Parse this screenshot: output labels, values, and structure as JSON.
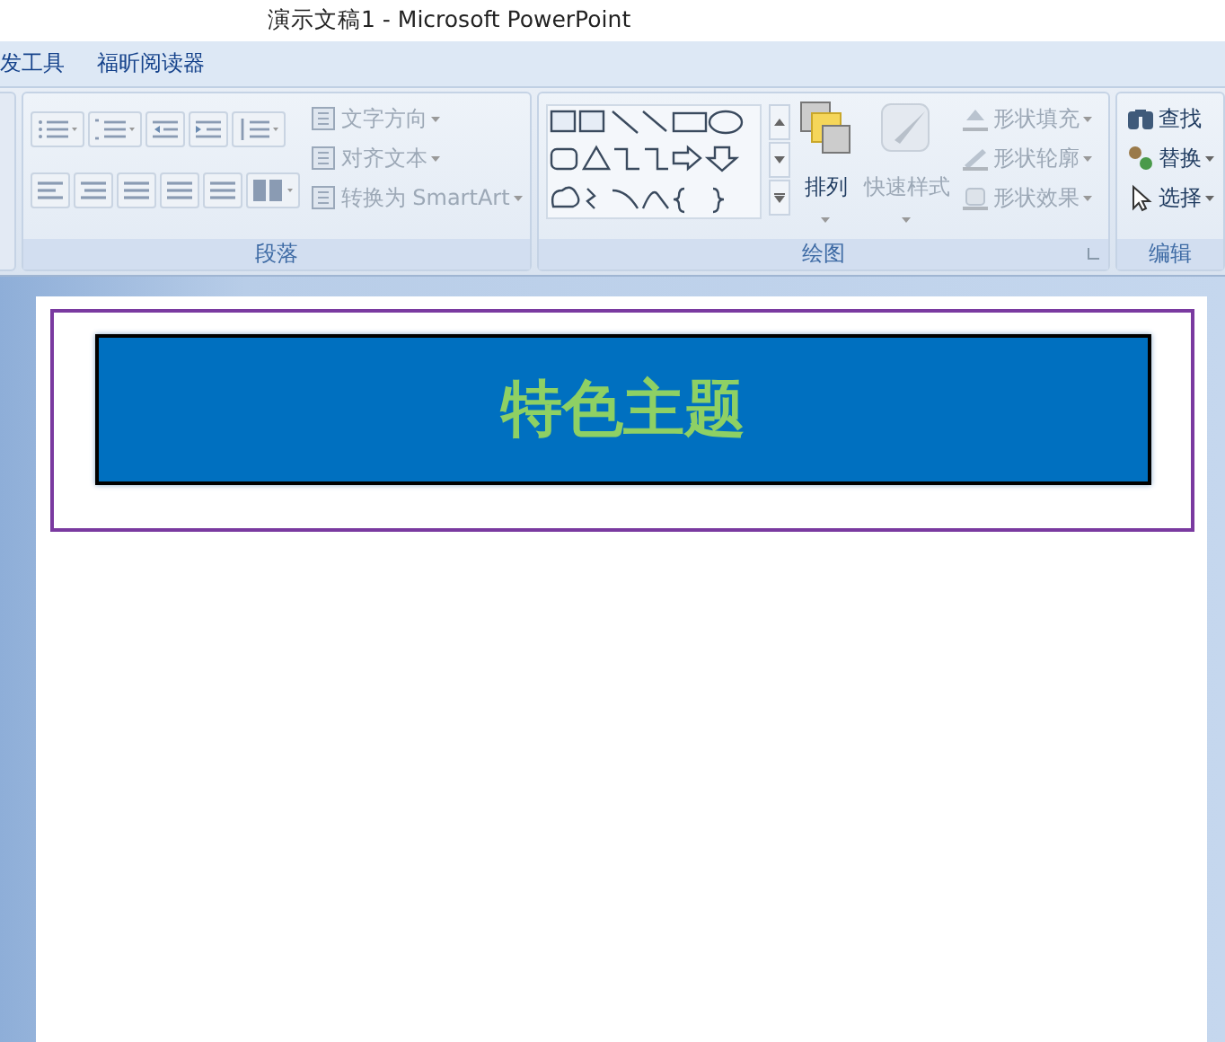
{
  "window": {
    "title": "演示文稿1 - Microsoft PowerPoint"
  },
  "tabs": [
    {
      "label": "发工具",
      "selected": false
    },
    {
      "label": "福昕阅读器",
      "selected": false
    }
  ],
  "ribbon": {
    "groups": [
      {
        "kind": "paragraph",
        "label": "段落",
        "commands": [
          {
            "label": "文字方向",
            "disabled": true
          },
          {
            "label": "对齐文本",
            "disabled": true
          },
          {
            "label": "转换为 SmartArt",
            "disabled": true
          }
        ]
      },
      {
        "kind": "drawing",
        "label": "绘图",
        "arrange": {
          "label": "排列",
          "disabled": false
        },
        "quick_styles": {
          "label": "快速样式",
          "disabled": true
        },
        "commands": [
          {
            "label": "形状填充",
            "disabled": true
          },
          {
            "label": "形状轮廓",
            "disabled": true
          },
          {
            "label": "形状效果",
            "disabled": true
          }
        ]
      },
      {
        "kind": "editing",
        "label": "编辑",
        "commands": [
          {
            "label": "查找",
            "disabled": false
          },
          {
            "label": "替换",
            "disabled": false
          },
          {
            "label": "选择",
            "disabled": false
          }
        ]
      }
    ]
  },
  "slide": {
    "title": "特色主题",
    "selected": true
  }
}
